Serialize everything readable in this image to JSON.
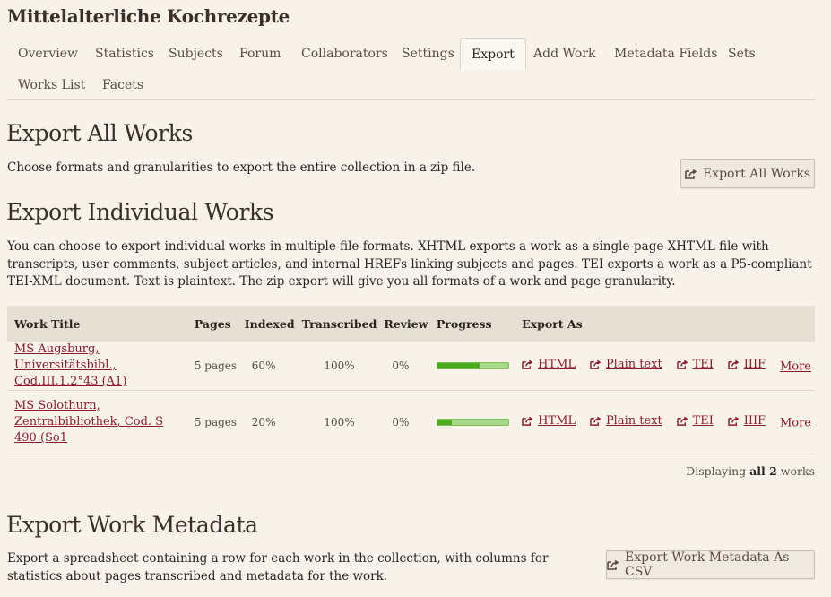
{
  "collection_title": "Mittelalterliche Kochrezepte",
  "tabs": [
    {
      "label": "Overview"
    },
    {
      "label": "Statistics"
    },
    {
      "label": "Subjects"
    },
    {
      "label": "Forum"
    },
    {
      "label": "Collaborators"
    },
    {
      "label": "Settings"
    },
    {
      "label": "Export",
      "active": true
    },
    {
      "label": "Add Work"
    },
    {
      "label": "Metadata Fields"
    },
    {
      "label": "Sets"
    },
    {
      "label": "Works List"
    },
    {
      "label": "Facets"
    }
  ],
  "export_all": {
    "heading": "Export All Works",
    "description": "Choose formats and granularities to export the entire collection in a zip file.",
    "button_label": "Export All Works"
  },
  "export_individual": {
    "heading": "Export Individual Works",
    "description": "You can choose to export individual works in multiple file formats. XHTML exports a work as a single-page XHTML file with transcripts, user comments, subject articles, and internal HREFs linking subjects and pages. TEI exports a work as a P5-compliant TEI-XML document. Text is plaintext. The zip export will give you all formats of a work and page granularity."
  },
  "table": {
    "headers": {
      "title": "Work Title",
      "pages": "Pages",
      "indexed": "Indexed",
      "transcribed": "Transcribed",
      "review": "Review",
      "progress": "Progress",
      "export": "Export As"
    },
    "rows": [
      {
        "title": "MS Augsburg, Universitätsbibl., Cod.III.1.2°43 (A1)",
        "pages": "5 pages",
        "indexed": "60%",
        "transcribed": "100%",
        "review": "0%",
        "progress_indexed": 0.6,
        "exports": {
          "html": "HTML",
          "plain": "Plain text",
          "tei": "TEI",
          "iiif": "IIIF",
          "more": "More"
        }
      },
      {
        "title": "MS Solothurn, Zentralbibliothek, Cod. S 490 (So1",
        "pages": "5 pages",
        "indexed": "20%",
        "transcribed": "100%",
        "review": "0%",
        "progress_indexed": 0.2,
        "exports": {
          "html": "HTML",
          "plain": "Plain text",
          "tei": "TEI",
          "iiif": "IIIF",
          "more": "More"
        }
      }
    ],
    "footer": {
      "prefix": "Displaying",
      "count": "all 2",
      "suffix": "works"
    }
  },
  "export_metadata": {
    "heading": "Export Work Metadata",
    "description": "Export a spreadsheet containing a row for each work in the collection, with columns for statistics about pages transcribed and metadata for the work.",
    "button_label": "Export Work Metadata As CSV"
  },
  "icons": {
    "export": "external-link-icon"
  },
  "colors": {
    "background": "#f8f3ea",
    "link": "#8a1c2b",
    "progress_dark": "#4caa1e",
    "progress_light": "#a8d98a"
  }
}
